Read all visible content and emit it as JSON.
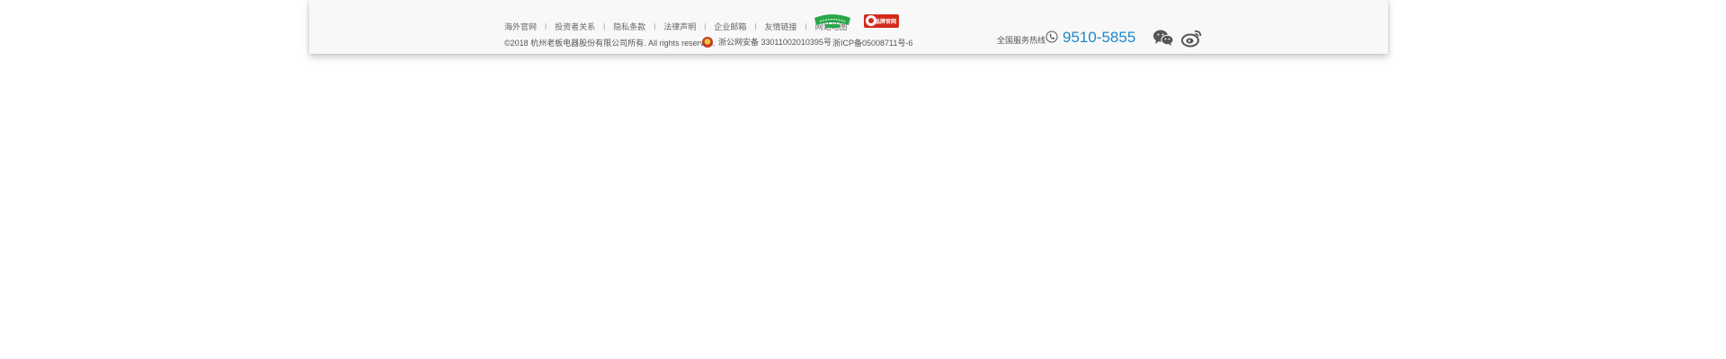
{
  "footer": {
    "nav_links": [
      {
        "label": "海外官网"
      },
      {
        "label": "投资者关系"
      },
      {
        "label": "隐私条款"
      },
      {
        "label": "法律声明"
      },
      {
        "label": "企业邮箱"
      },
      {
        "label": "友情链接"
      },
      {
        "label": "网站地图"
      }
    ],
    "nav_separator": "|",
    "copyright": "©2018 杭州老板电器股份有限公司所有. All rights reserved.",
    "police_record": "浙公网安备 33011002010395号",
    "icp_record": "浙ICP备05008711号-6",
    "hotline_label": "全国服务热线",
    "hotline_number": "9510-5855",
    "badge_red_text": "品牌官网",
    "icons": {
      "phone": "phone-icon",
      "wechat": "wechat-icon",
      "weibo": "weibo-icon",
      "police": "police-emblem-icon",
      "verified": "verified-site-badge-icon"
    },
    "colors": {
      "hotline": "#1e88c9",
      "badge_green": "#2aa84a",
      "badge_red": "#d42a1c",
      "panel_bg": "#f8f8f8"
    }
  }
}
